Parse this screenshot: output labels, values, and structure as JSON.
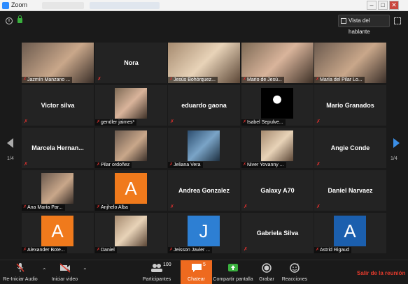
{
  "window": {
    "title": "Zoom"
  },
  "topbar": {
    "speaker_view": "Vista del hablante"
  },
  "pagination": {
    "left": "1/4",
    "right": "1/4"
  },
  "tiles": [
    {
      "name": "Jazmín Manzano ...",
      "type": "video",
      "active": true
    },
    {
      "name": "Nora",
      "type": "name"
    },
    {
      "name": "Jesús Bohórquez...",
      "type": "video"
    },
    {
      "name": "Mario de Jesú...",
      "type": "video"
    },
    {
      "name": "María del Pilar Lo...",
      "type": "video"
    },
    {
      "name": "Victor silva",
      "type": "name"
    },
    {
      "name": "gendler jaimes*",
      "type": "photo"
    },
    {
      "name": "eduardo gaona",
      "type": "name"
    },
    {
      "name": "Isabel Sepulve...",
      "type": "photo"
    },
    {
      "name": "Mario Granados",
      "type": "name"
    },
    {
      "name": "Marcela Hernan...",
      "type": "name"
    },
    {
      "name": "Pilar ordoñez",
      "type": "photo"
    },
    {
      "name": "Jeliana Vera",
      "type": "photo"
    },
    {
      "name": "Niver Yovanny ...",
      "type": "photo"
    },
    {
      "name": "Angie Conde",
      "type": "name"
    },
    {
      "name": "Ana María Par...",
      "type": "photo"
    },
    {
      "name": "Anjhelo Alba",
      "type": "letter",
      "letter": "A",
      "color": "#f07a1c"
    },
    {
      "name": "Andrea Gonzalez",
      "type": "name"
    },
    {
      "name": "Galaxy A70",
      "type": "name"
    },
    {
      "name": "Daniel Narvaez",
      "type": "name"
    },
    {
      "name": "Alexander Bote...",
      "type": "letter",
      "letter": "A",
      "color": "#f07a1c"
    },
    {
      "name": "Daniel",
      "type": "photo"
    },
    {
      "name": "Jeisson Javier ...",
      "type": "letter",
      "letter": "J",
      "color": "#2d7fd3"
    },
    {
      "name": "Gabriela Silva",
      "type": "name"
    },
    {
      "name": "Astrid Rigaud",
      "type": "letter",
      "letter": "A",
      "color": "#1b5fae"
    }
  ],
  "toolbar": {
    "audio": "Re-Iniciar Audio",
    "video": "Iniciar video",
    "participants": "Participantes",
    "participants_count": "100",
    "chat": "Chatear",
    "chat_badge": "5",
    "share": "Compartir pantalla",
    "record": "Grabar",
    "reactions": "Reacciones",
    "leave": "Salir de la reunión"
  }
}
